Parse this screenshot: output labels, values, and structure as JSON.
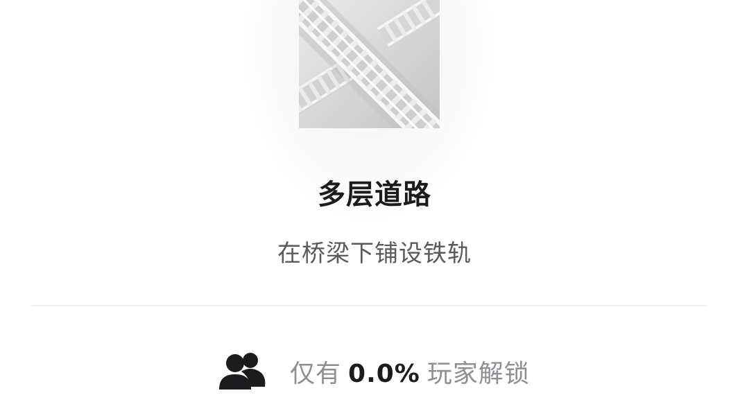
{
  "achievement": {
    "title": "多层道路",
    "description": "在桥梁下铺设铁轨",
    "icon": "stacked-railway-bridge"
  },
  "stats": {
    "prefix": "仅有",
    "percent": "0.0%",
    "suffix": "玩家解锁",
    "icon": "users-icon"
  }
}
